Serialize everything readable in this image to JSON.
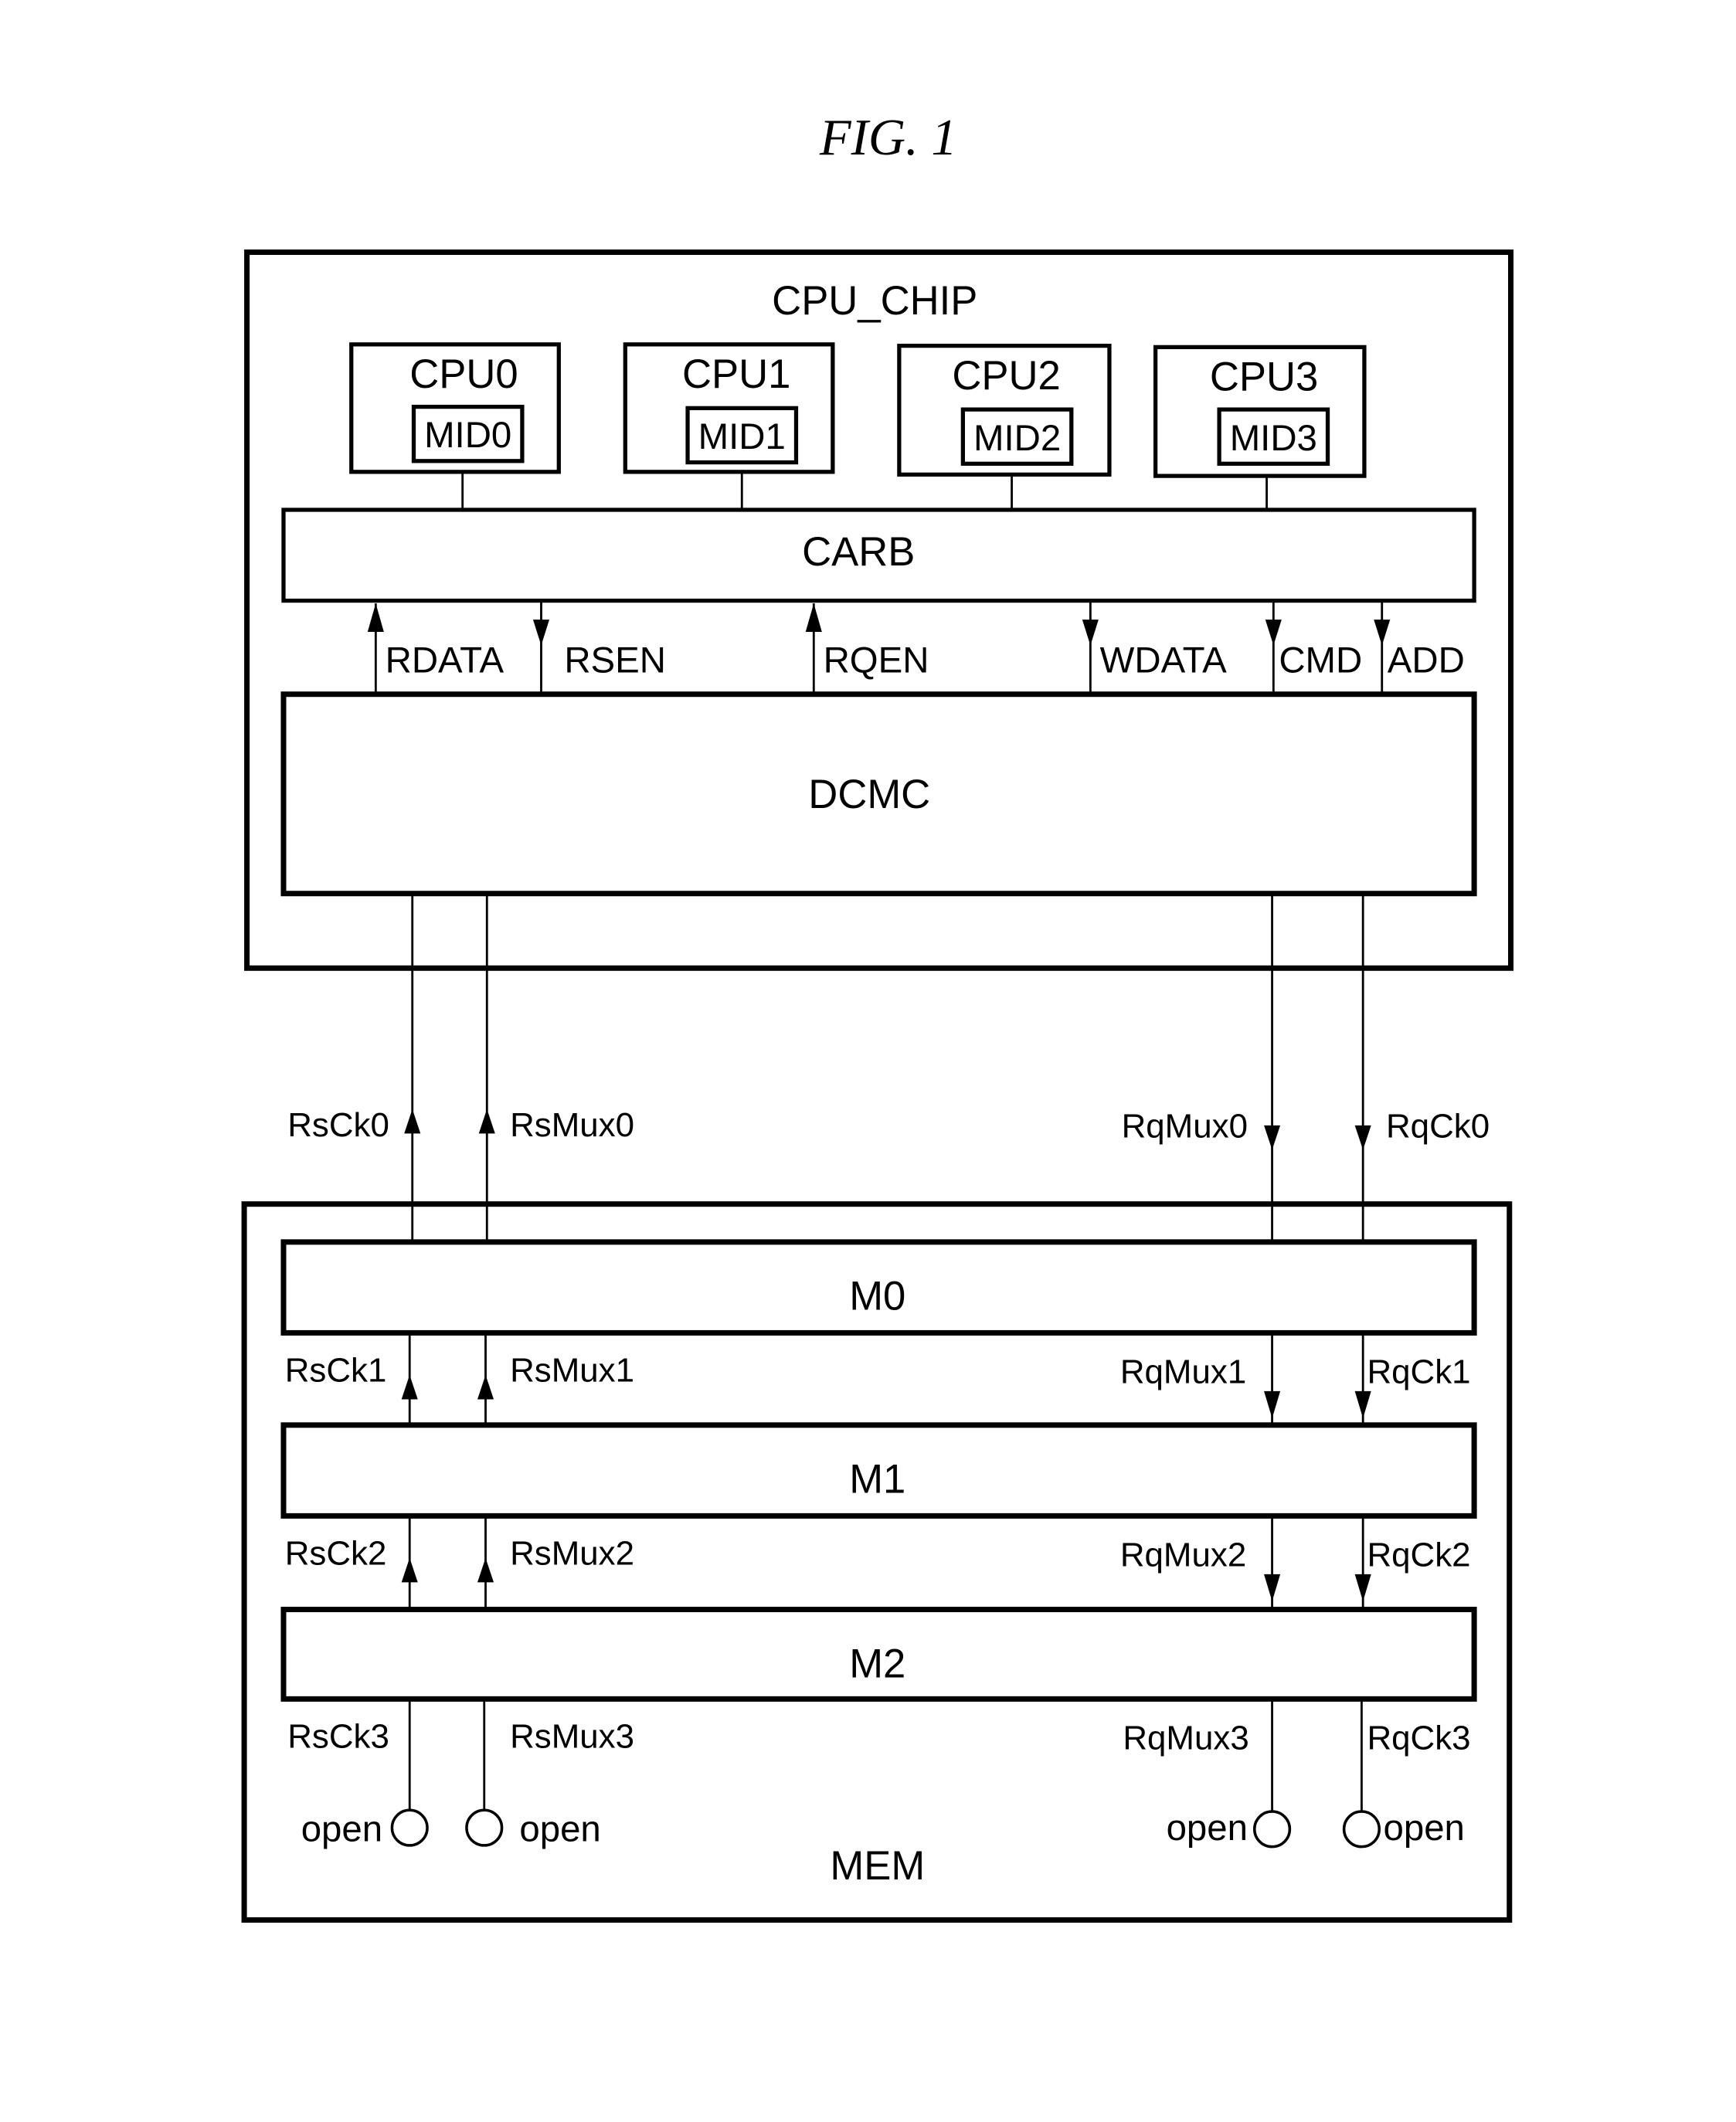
{
  "figure": {
    "title": "FIG. 1"
  },
  "cpu_chip": {
    "label": "CPU_CHIP",
    "cpus": [
      {
        "name": "CPU0",
        "mid": "MID0"
      },
      {
        "name": "CPU1",
        "mid": "MID1"
      },
      {
        "name": "CPU2",
        "mid": "MID2"
      },
      {
        "name": "CPU3",
        "mid": "MID3"
      }
    ],
    "carb": "CARB",
    "dcmc": "DCMC",
    "signals": [
      {
        "name": "RDATA",
        "direction": "up"
      },
      {
        "name": "RSEN",
        "direction": "down"
      },
      {
        "name": "RQEN",
        "direction": "up"
      },
      {
        "name": "WDATA",
        "direction": "down"
      },
      {
        "name": "CMD",
        "direction": "down"
      },
      {
        "name": "ADD",
        "direction": "down"
      }
    ]
  },
  "links": {
    "rows": [
      {
        "rsck": "RsCk0",
        "rsmux": "RsMux0",
        "rqmux": "RqMux0",
        "rqck": "RqCk0"
      },
      {
        "rsck": "RsCk1",
        "rsmux": "RsMux1",
        "rqmux": "RqMux1",
        "rqck": "RqCk1"
      },
      {
        "rsck": "RsCk2",
        "rsmux": "RsMux2",
        "rqmux": "RqMux2",
        "rqck": "RqCk2"
      },
      {
        "rsck": "RsCk3",
        "rsmux": "RsMux3",
        "rqmux": "RqMux3",
        "rqck": "RqCk3"
      }
    ],
    "response_direction": "up",
    "request_direction": "down"
  },
  "mem": {
    "label": "MEM",
    "modules": [
      "M0",
      "M1",
      "M2"
    ],
    "terminations": [
      "open",
      "open",
      "open",
      "open"
    ]
  }
}
